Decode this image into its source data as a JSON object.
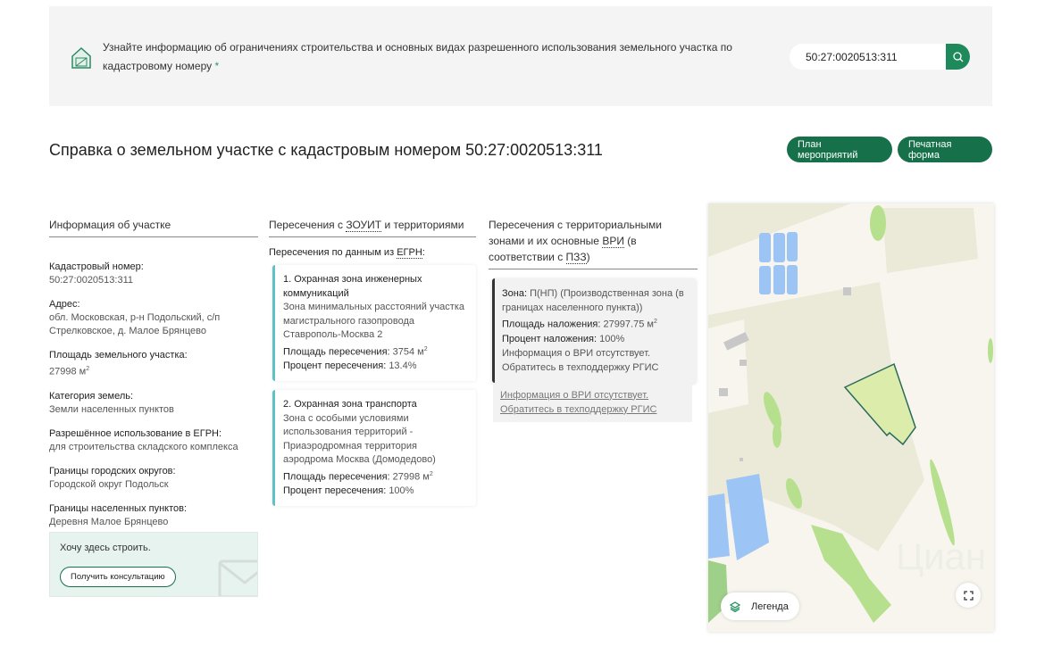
{
  "banner": {
    "text": "Узнайте информацию об ограничениях строительства и основных видах разрешенного использования земельного участка по кадастровому номеру",
    "asterisk": "*",
    "search_value": "50:27:0020513:311"
  },
  "title": "Справка о земельном участке с кадастровым номером 50:27:0020513:311",
  "buttons": {
    "plan": "План мероприятий",
    "print": "Печатная форма"
  },
  "info": {
    "heading": "Информация об участке",
    "fields": [
      {
        "label": "Кадастровый номер:",
        "value": "50:27:0020513:311"
      },
      {
        "label": "Адрес:",
        "value": "обл. Московская, р-н Подольский, с/п Стрелковское, д. Малое Брянцево"
      },
      {
        "label": "Площадь земельного участка:",
        "value": "27998 м",
        "sup": "2"
      },
      {
        "label": "Категория земель:",
        "value": "Земли населенных пунктов"
      },
      {
        "label": "Разрешённое использование в ЕГРН:",
        "value": "для строительства складского комплекса"
      },
      {
        "label": "Границы городских округов:",
        "value": "Городской округ Подольск"
      },
      {
        "label": "Границы населенных пунктов:",
        "value": "Деревня Малое Брянцево"
      }
    ],
    "cta_text": "Хочу здесь строить.",
    "cta_button": "Получить консультацию"
  },
  "zouit": {
    "heading_pre": "Пересечения с ",
    "heading_abbr": "ЗОУИТ",
    "heading_post": " и территориями",
    "sub_pre": "Пересечения по данным из ",
    "sub_abbr": "ЕГРН",
    "sub_post": ":",
    "items": [
      {
        "title": "1. Охранная зона инженерных коммуникаций",
        "desc": "Зона минимальных расстояний участка магистрального газопровода Ставрополь-Москва 2",
        "area_label": "Площадь пересечения:",
        "area": "3754 м",
        "percent_label": "Процент пересечения:",
        "percent": "13.4%"
      },
      {
        "title": "2. Охранная зона транспорта",
        "desc": "Зона с особыми условиями использования территорий - Приаэродромная территория аэродрома Москва (Домодедово)",
        "area_label": "Площадь пересечения:",
        "area": "27998 м",
        "percent_label": "Процент пересечения:",
        "percent": "100%"
      }
    ]
  },
  "zones": {
    "heading_pre": "Пересечения с территориальными зонами и их основные ",
    "heading_abbr1": "ВРИ",
    "heading_mid": " (в соответствии с ",
    "heading_abbr2": "ПЗЗ",
    "heading_post": ")",
    "zone_label": "Зона:",
    "zone": "П(НП) (Производственная зона (в границах населенного пункта))",
    "area_label": "Площадь наложения:",
    "area": "27997.75 м",
    "percent_label": "Процент наложения:",
    "percent": "100%",
    "note": "Информация о ВРИ отсутствует. Обратитесь в техподдержку РГИС",
    "link": "Информация о ВРИ отсутствует. Обратитесь в техподдержку РГИС"
  },
  "map": {
    "legend": "Легенда",
    "watermark": "Циан"
  },
  "colors": {
    "accent": "#16704a",
    "plot_fill": "#dcedab",
    "plot_stroke": "#2b6a5a",
    "water": "#9cc4f5",
    "forest": "#b7e08e"
  }
}
